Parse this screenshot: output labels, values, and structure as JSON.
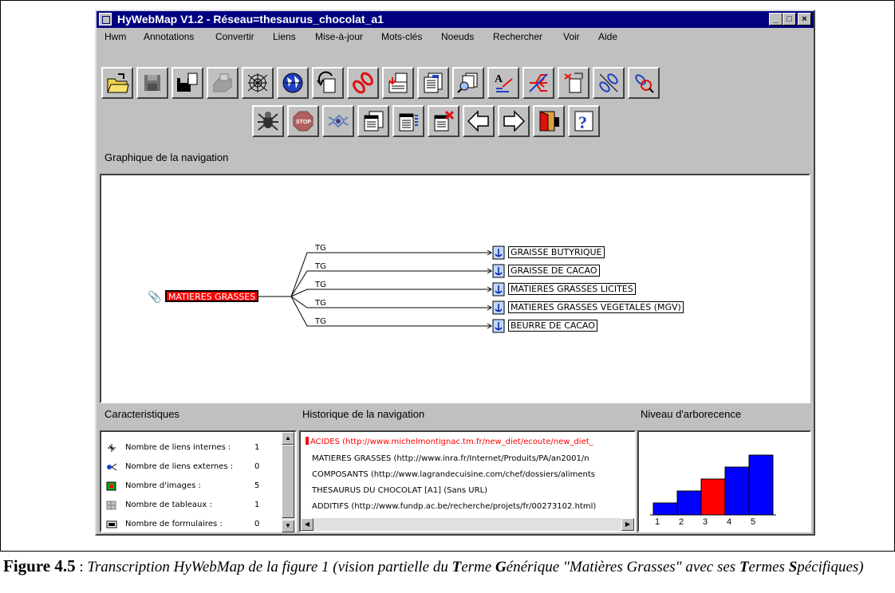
{
  "window": {
    "title": "HyWebMap V1.2 - Réseau=thesaurus_chocolat_a1",
    "controls": {
      "minimize": "_",
      "maximize": "□",
      "close": "×"
    }
  },
  "menubar": [
    "Hwm",
    "Annotations",
    "Convertir",
    "Liens",
    "Mise-à-jour",
    "Mots-clés",
    "Noeuds",
    "Rechercher",
    "Voir",
    "Aide"
  ],
  "toolbar_row1": [
    "open-folder-icon",
    "save-disk-icon",
    "save-as-icon",
    "print-icon",
    "network-web-icon",
    "globe-icon",
    "undo-doc-icon",
    "link-chain-icon",
    "import-doc-icon",
    "doc-list-icon",
    "doc-search-icon",
    "text-edit-icon",
    "tree-icon",
    "doc-link-icon",
    "link-edit-icon",
    "link-search-icon"
  ],
  "toolbar_row2": [
    "spider-icon",
    "stop-icon",
    "crawl-icon",
    "window-icon",
    "window-list-icon",
    "window-delete-icon",
    "arrow-left-icon",
    "arrow-right-icon",
    "exit-door-icon",
    "help-icon"
  ],
  "graph": {
    "label": "Graphique de la navigation",
    "root": "MATIERES GRASSES",
    "relation": "TG",
    "children": [
      "GRAISSE BUTYRIQUE",
      "GRAISSE DE CACAO",
      "MATIERES GRASSES LICITES",
      "MATIERES GRASSES VEGETALES (MGV)",
      "BEURRE DE CACAO"
    ],
    "accent": "#ff0000"
  },
  "caracteristiques": {
    "label": "Caracteristiques",
    "rows": [
      {
        "icon": "internal-links-icon",
        "label": "Nombre de liens internes :",
        "value": "1"
      },
      {
        "icon": "external-links-icon",
        "label": "Nombre de liens externes :",
        "value": "0"
      },
      {
        "icon": "images-icon",
        "label": "Nombre d'images :",
        "value": "5"
      },
      {
        "icon": "tables-icon",
        "label": "Nombre de tableaux :",
        "value": "1"
      },
      {
        "icon": "forms-icon",
        "label": "Nombre de formulaires :",
        "value": "0"
      }
    ]
  },
  "historique": {
    "label": "Historique de la navigation",
    "rows": [
      {
        "text": "ACIDES (http://www.michelmontignac.tm.fr/new_diet/ecoute/new_diet_",
        "selected": true
      },
      {
        "text": "MATIERES GRASSES (http://www.inra.fr/Internet/Produits/PA/an2001/n",
        "selected": false
      },
      {
        "text": "COMPOSANTS (http://www.lagrandecuisine.com/chef/dossiers/aliments",
        "selected": false
      },
      {
        "text": "THESAURUS DU CHOCOLAT [A1] (Sans URL)",
        "selected": false
      },
      {
        "text": "ADDITIFS (http://www.fundp.ac.be/recherche/projets/fr/00273102.html)",
        "selected": false
      }
    ]
  },
  "niveau": {
    "label": "Niveau d'arborecence",
    "levels": [
      "1",
      "2",
      "3",
      "4",
      "5"
    ],
    "values": [
      1,
      2,
      3,
      4,
      5
    ],
    "highlight": 3,
    "bar_color": "#0000ff",
    "highlight_color": "#ff0000"
  },
  "caption": {
    "fig": "Figure 4.5",
    "sep": " : ",
    "parts": [
      {
        "t": "Transcription HyWebMap de la figure 1 (vision partielle du ",
        "b": false
      },
      {
        "t": "T",
        "b": true
      },
      {
        "t": "erme ",
        "b": false
      },
      {
        "t": "G",
        "b": true
      },
      {
        "t": "énérique \"Matières Grasses\" avec ses ",
        "b": false
      },
      {
        "t": "T",
        "b": true
      },
      {
        "t": "ermes ",
        "b": false
      },
      {
        "t": "S",
        "b": true
      },
      {
        "t": "pécifiques)",
        "b": false
      }
    ]
  }
}
